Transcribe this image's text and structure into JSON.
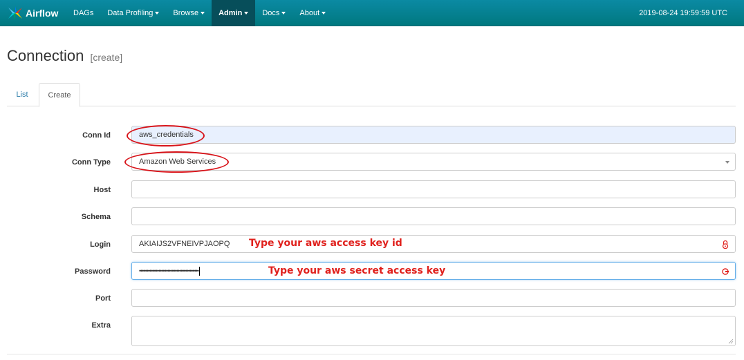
{
  "navbar": {
    "brand": "Airflow",
    "items": [
      {
        "label": "DAGs",
        "dropdown": false
      },
      {
        "label": "Data Profiling",
        "dropdown": true
      },
      {
        "label": "Browse",
        "dropdown": true
      },
      {
        "label": "Admin",
        "dropdown": true,
        "active": true
      },
      {
        "label": "Docs",
        "dropdown": true
      },
      {
        "label": "About",
        "dropdown": true
      }
    ],
    "timestamp": "2019-08-24 19:59:59 UTC"
  },
  "page": {
    "title": "Connection",
    "subtitle": "[create]"
  },
  "tabs": {
    "list": "List",
    "create": "Create"
  },
  "form": {
    "conn_id": {
      "label": "Conn Id",
      "value": "aws_credentials"
    },
    "conn_type": {
      "label": "Conn Type",
      "value": "Amazon Web Services"
    },
    "host": {
      "label": "Host",
      "value": ""
    },
    "schema": {
      "label": "Schema",
      "value": ""
    },
    "login": {
      "label": "Login",
      "value": "AKIAIJS2VFNEIVPJAOPQ"
    },
    "password": {
      "label": "Password",
      "value": "••••••••••••••••••••••••••••••••••••••••"
    },
    "port": {
      "label": "Port",
      "value": ""
    },
    "extra": {
      "label": "Extra",
      "value": ""
    }
  },
  "annotations": {
    "login_note": "Type your aws access key id",
    "password_note": "Type your aws secret access key"
  },
  "colors": {
    "navbar": "#00787f",
    "active_nav": "#074e5a",
    "annotation": "#e0201c",
    "autofill": "#e8f0fe"
  }
}
